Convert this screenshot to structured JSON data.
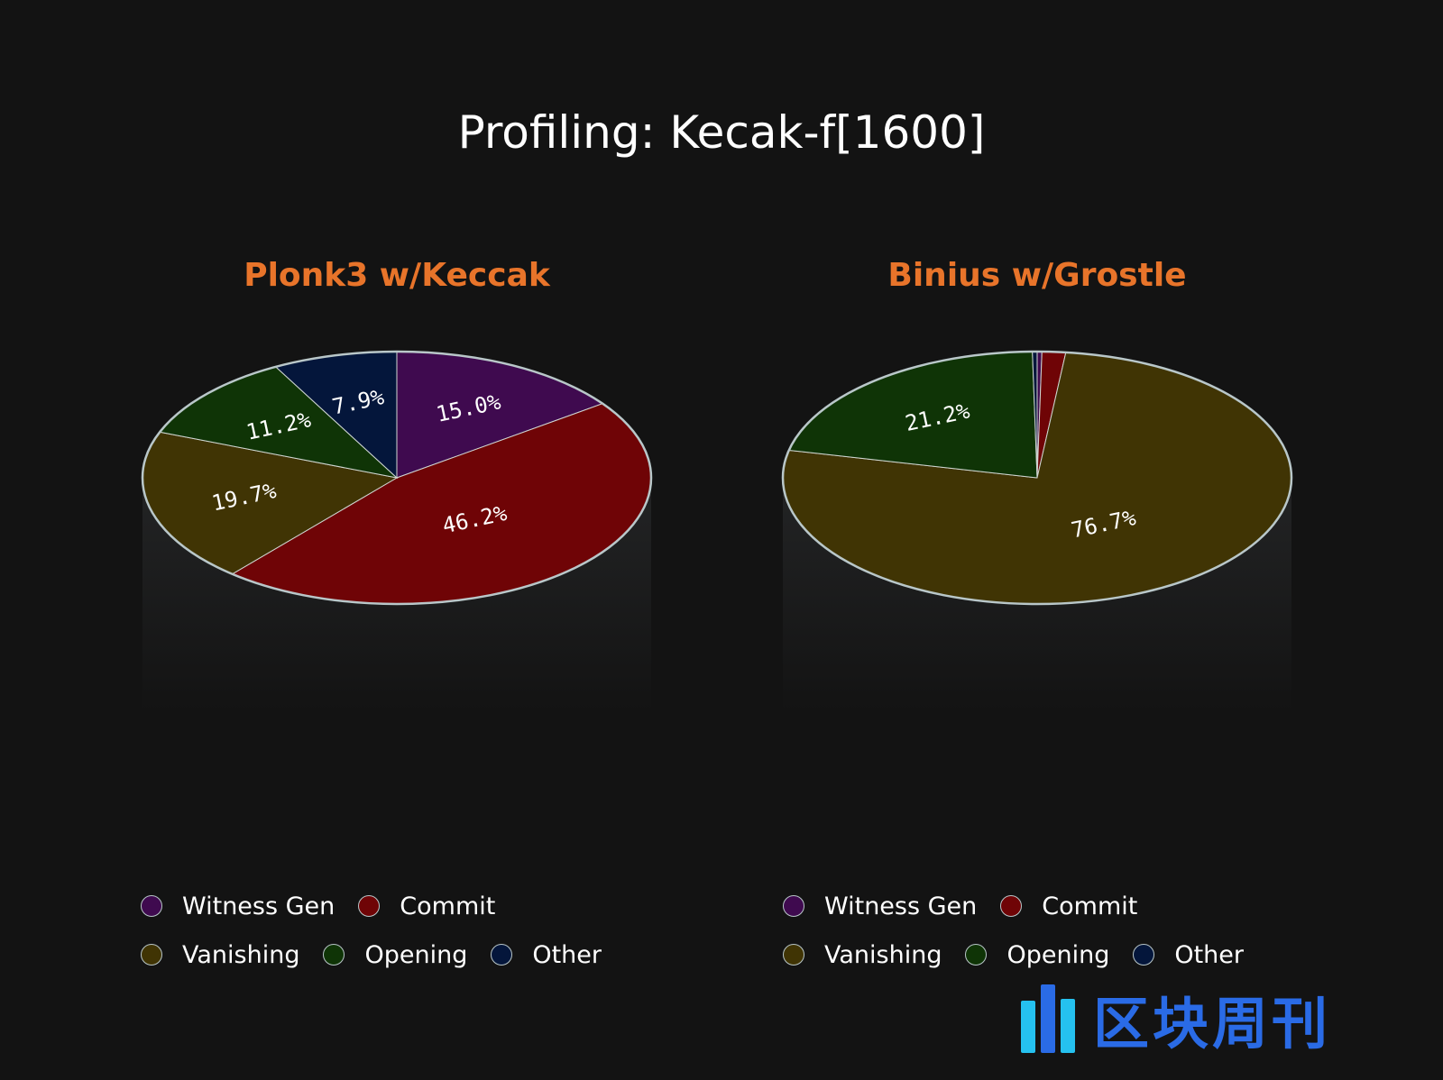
{
  "title": "Profiling: Kecak-f[1600]",
  "colors": {
    "Witness Gen": "#3f0a4f",
    "Commit": "#6f0406",
    "Vanishing": "#403404",
    "Opening": "#0f3406",
    "Other": "#04163b",
    "title_accent": "#e8742a",
    "edge": "#b9c7c9"
  },
  "chart_data": [
    {
      "type": "pie",
      "title": "Plonk3 w/Keccak",
      "style": "3d-cylinder",
      "categories": [
        "Witness Gen",
        "Commit",
        "Vanishing",
        "Opening",
        "Other"
      ],
      "values": [
        15.0,
        46.2,
        19.7,
        11.2,
        7.9
      ],
      "labels": [
        "15.0%",
        "46.2%",
        "19.7%",
        "11.2%",
        "7.9%"
      ],
      "start": "top, clockwise",
      "legend": "bottom"
    },
    {
      "type": "pie",
      "title": "Binius w/Grostle",
      "style": "3d-cylinder",
      "categories": [
        "Witness Gen",
        "Commit",
        "Vanishing",
        "Opening",
        "Other"
      ],
      "values": [
        0.3,
        1.5,
        76.7,
        21.2,
        0.3
      ],
      "labels": [
        "",
        "",
        "76.7%",
        "21.2%",
        ""
      ],
      "start": "top, clockwise",
      "legend": "bottom"
    }
  ],
  "legend": {
    "row1": [
      "Witness Gen",
      "Commit"
    ],
    "row2": [
      "Vanishing",
      "Opening",
      "Other"
    ]
  },
  "watermark": "区块周刊"
}
